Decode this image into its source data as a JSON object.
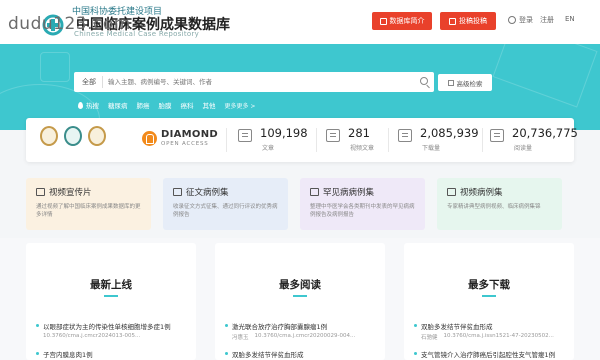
{
  "watermark": "dudu123.com",
  "header": {
    "org": "中国科协委托建设项目",
    "title": "中国临床案例成果数据库",
    "subtitle": "Chinese Medical Case Repository",
    "buttons": [
      {
        "label": "数据库简介"
      },
      {
        "label": "投稿投稿"
      }
    ],
    "login_label": "登录",
    "register_label": "注册",
    "lang_label": "EN"
  },
  "hero": {
    "search_category": "全部",
    "search_placeholder": "输入主题、病例编号、关键词、作者",
    "advanced_label": "高级检索",
    "hot_label": "热搜",
    "hot_terms": [
      "糖尿病",
      "肺癌",
      "胎膜",
      "癌科",
      "其他"
    ],
    "hot_more": "更多更多 >"
  },
  "stats": {
    "diamond_title": "DIAMOND",
    "diamond_sub": "OPEN ACCESS",
    "items": [
      {
        "value": "109,198",
        "label": "文章",
        "icon": "document-icon"
      },
      {
        "value": "281",
        "label": "视频文章",
        "icon": "video-icon"
      },
      {
        "value": "2,085,939",
        "label": "下载量",
        "icon": "download-icon"
      },
      {
        "value": "20,736,775",
        "label": "阅读量",
        "icon": "book-icon"
      }
    ]
  },
  "cards": [
    {
      "title": "视频宣传片",
      "desc": "通过视频了解中国临床案例成果数据库的更多详情",
      "bg": "#fbf1e1",
      "icon": "video-card-icon"
    },
    {
      "title": "征文病例集",
      "desc": "收录征文方式征集、通过同行评议的优秀病例报告",
      "bg": "#e6edf8",
      "icon": "document-card-icon"
    },
    {
      "title": "罕见病病例集",
      "desc": "整理中华医学会各类期刊中发表的罕见病病例报告及病例报告",
      "bg": "#efe9f8",
      "icon": "rare-card-icon"
    },
    {
      "title": "视频病例集",
      "desc": "专家精讲典型病例视频、临床病例集锦",
      "bg": "#e6f6ee",
      "icon": "video-case-icon"
    }
  ],
  "columns": [
    {
      "title": "最新上线",
      "items": [
        {
          "title": "以眼部症状为主的传染性单核细胞增多症1例",
          "meta1": "",
          "meta2": "10.3760/cma.j.cmcr2024013-005..."
        },
        {
          "title": "子宫内膜息肉1例",
          "meta1": "",
          "meta2": ""
        }
      ]
    },
    {
      "title": "最多阅读",
      "items": [
        {
          "title": "激光联合放疗治疗胸部囊腺瘤1例",
          "meta1": "冯惠玉",
          "meta2": "10.3760/cma.j.cmcr20200029-004..."
        },
        {
          "title": "双胎多发结节伴贫血形成",
          "meta1": "",
          "meta2": ""
        }
      ]
    },
    {
      "title": "最多下载",
      "items": [
        {
          "title": "双胎多发结节伴贫血形成",
          "meta1": "石驰健",
          "meta2": "10.3760/cma.j.issn1521-47-20230502..."
        },
        {
          "title": "支气管镜介入治疗肺癌后引起腔性支气管瘘1例",
          "meta1": "",
          "meta2": ""
        }
      ]
    }
  ],
  "colors": {
    "accent": "#3ec7cf",
    "button_red": "#e9412b"
  }
}
